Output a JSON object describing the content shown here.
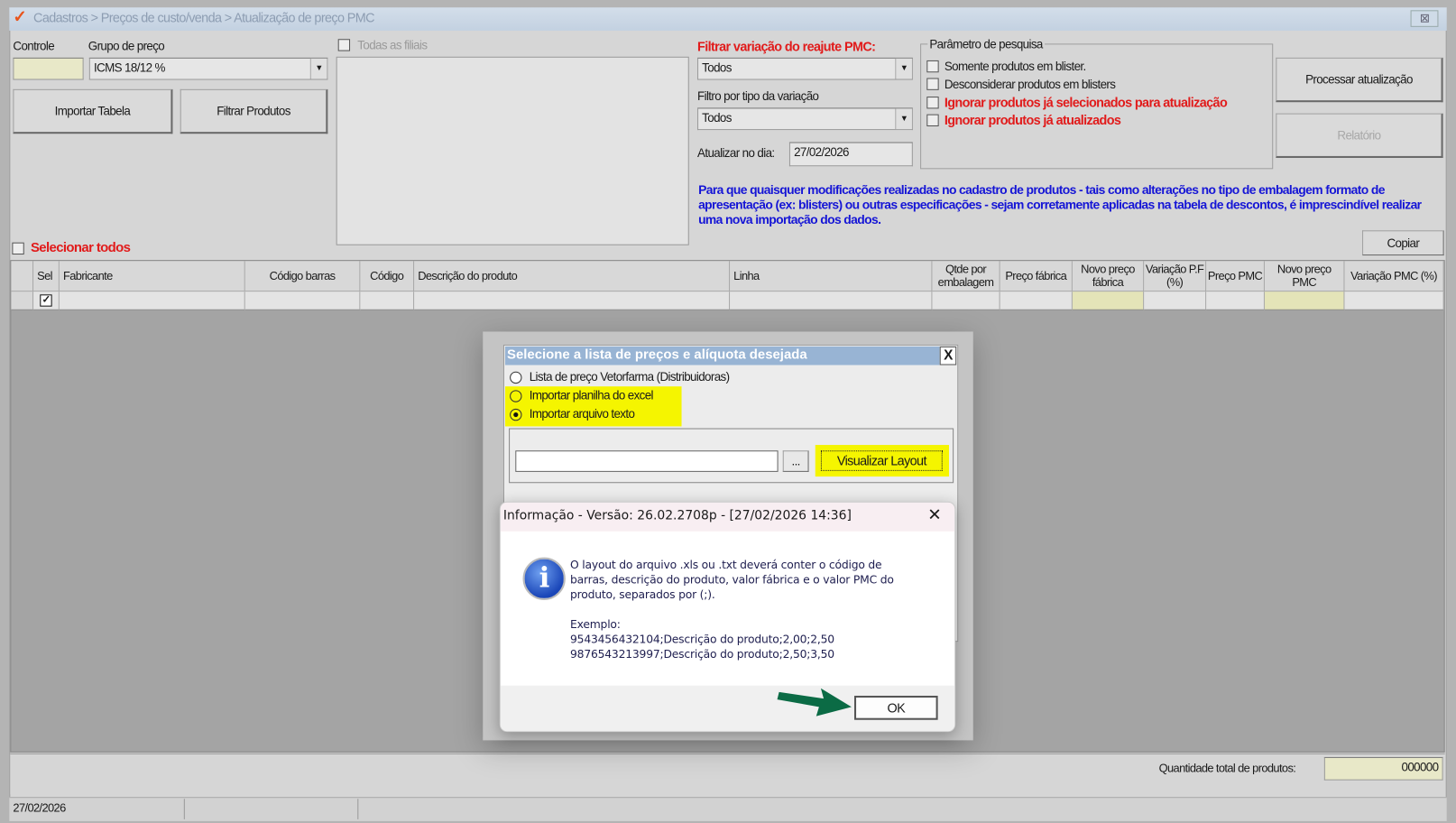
{
  "window": {
    "title": "Cadastros > Preços de custo/venda > Atualização de preço PMC",
    "close": "⊠"
  },
  "top": {
    "controle_label": "Controle",
    "controle_value": "",
    "grupo_label": "Grupo de preço",
    "grupo_value": "ICMS 18/12 %",
    "importar_tabela": "Importar Tabela",
    "filtrar_produtos": "Filtrar Produtos",
    "todas_filiais": "Todas as filiais"
  },
  "filters": {
    "variacao_label": "Filtrar variação do reajute PMC:",
    "variacao_value": "Todos",
    "tipo_label": "Filtro por tipo da variação",
    "tipo_value": "Todos",
    "atualizar_label": "Atualizar no dia:",
    "atualizar_value": "27/02/2026"
  },
  "params": {
    "title": "Parâmetro de pesquisa",
    "items": [
      "Somente produtos em blister.",
      "Desconsiderar produtos em blisters",
      "Ignorar produtos já selecionados para atualização",
      "Ignorar produtos já atualizados"
    ]
  },
  "actions": {
    "processar": "Processar atualização",
    "relatorio": "Relatório",
    "copiar": "Copiar"
  },
  "notice": "Para que quaisquer modificações realizadas no cadastro de produtos - tais como alterações no tipo de embalagem formato de apresentação (ex: blisters) ou outras especificações - sejam corretamente aplicadas na tabela de descontos, é imprescindível realizar uma nova importação dos dados.",
  "selecionar_todos": "Selecionar todos",
  "grid": {
    "columns": [
      "Sel",
      "Fabricante",
      "Código barras",
      "Código",
      "Descrição do produto",
      "Linha",
      "Qtde por embalagem",
      "Preço fábrica",
      "Novo preço fábrica",
      "Variação P.F (%)",
      "Preço PMC",
      "Novo preço PMC",
      "Variação PMC (%)"
    ]
  },
  "footer": {
    "quantidade_label": "Quantidade total de produtos:",
    "quantidade_value": "000000",
    "status_date": "27/02/2026"
  },
  "dialog": {
    "title": "Selecione a lista de preços e alíquota desejada",
    "close": "X",
    "options": [
      "Lista de preço Vetorfarma (Distribuidoras)",
      "Importar planilha do excel",
      "Importar arquivo texto"
    ],
    "selected": 2,
    "file_value": "",
    "browse": "...",
    "visualizar": "Visualizar Layout"
  },
  "info": {
    "title": "Informação - Versão: 26.02.2708p - [27/02/2026 14:36]",
    "close": "✕",
    "lines": [
      "O layout do arquivo .xls ou .txt deverá conter o código de",
      "barras, descrição do produto, valor fábrica e o valor PMC do",
      "produto, separados por (;)."
    ],
    "example_label": "Exemplo:",
    "examples": [
      "9543456432104;Descrição do produto;2,00;2,50",
      "9876543213997;Descrição do produto;2,50;3,50"
    ],
    "ok": "OK"
  },
  "colors": {
    "highlight": "#f5f500",
    "arrow": "#0b6b45",
    "dialog_title": "#98b4d4",
    "notice": "#1515d6",
    "warning": "#e11b1b"
  }
}
